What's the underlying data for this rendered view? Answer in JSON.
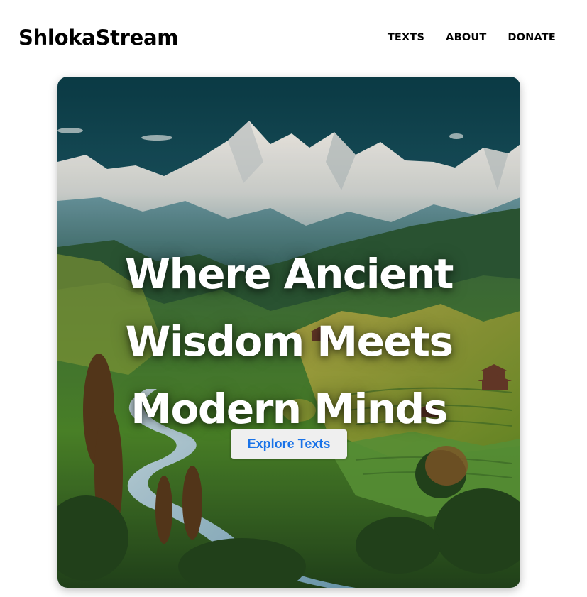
{
  "header": {
    "logo": "ShlokaStream",
    "nav": [
      {
        "label": "TEXTS"
      },
      {
        "label": "ABOUT"
      },
      {
        "label": "DONATE"
      }
    ]
  },
  "hero": {
    "headline_lines": [
      "Where Ancient",
      "Wisdom Meets",
      "Modern Minds"
    ],
    "cta_label": "Explore Texts",
    "image_subject": "himalayan-valley-landscape",
    "colors": {
      "sky": "#0f4f5c",
      "snow": "#f2f0ec",
      "valley_green": "#4f8a2a",
      "river": "#8fb8c9",
      "cta_text": "#1a73e8",
      "cta_bg": "#efefef"
    }
  }
}
